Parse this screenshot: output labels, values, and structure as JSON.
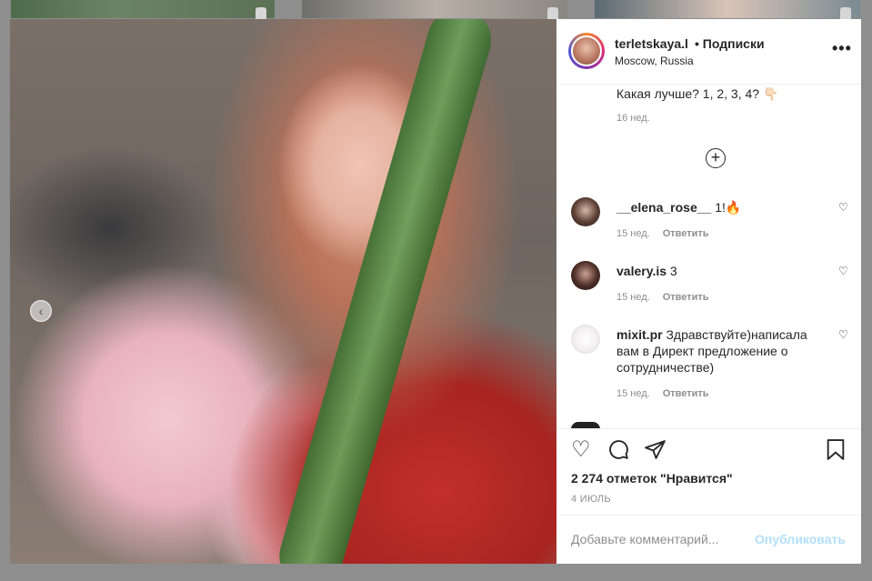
{
  "post": {
    "username": "terletskaya.l",
    "follow_label": "• Подписки",
    "location": "Moscow, Russia",
    "more_label": "•••",
    "caption": "Какая лучше? 1, 2, 3, 4? 👇🏻",
    "caption_time": "16 нед.",
    "load_more_label": "+"
  },
  "comments": [
    {
      "user": "__elena_rose__",
      "text": "1!🔥",
      "time": "15 нед.",
      "reply": "Ответить"
    },
    {
      "user": "valery.is",
      "text": "3",
      "time": "15 нед.",
      "reply": "Ответить"
    },
    {
      "user": "mixit.pr",
      "text": "Здравствуйте)написала вам в Директ предложение о сотрудничестве)",
      "time": "15 нед.",
      "reply": "Ответить"
    }
  ],
  "actions": {
    "like_icon": "heart-icon",
    "comment_icon": "comment-icon",
    "share_icon": "share-icon",
    "save_icon": "bookmark-icon",
    "likes_text": "2 274 отметок \"Нравится\"",
    "date": "4 ИЮЛЬ"
  },
  "comment_box": {
    "placeholder": "Добавьте комментарий...",
    "publish_label": "Опубликовать"
  },
  "photo": {
    "current_index": 3,
    "total": 4
  },
  "colors": {
    "accent": "#3897f0",
    "publish_disabled": "#b2dffc",
    "secondary_text": "#8e8e8e"
  }
}
